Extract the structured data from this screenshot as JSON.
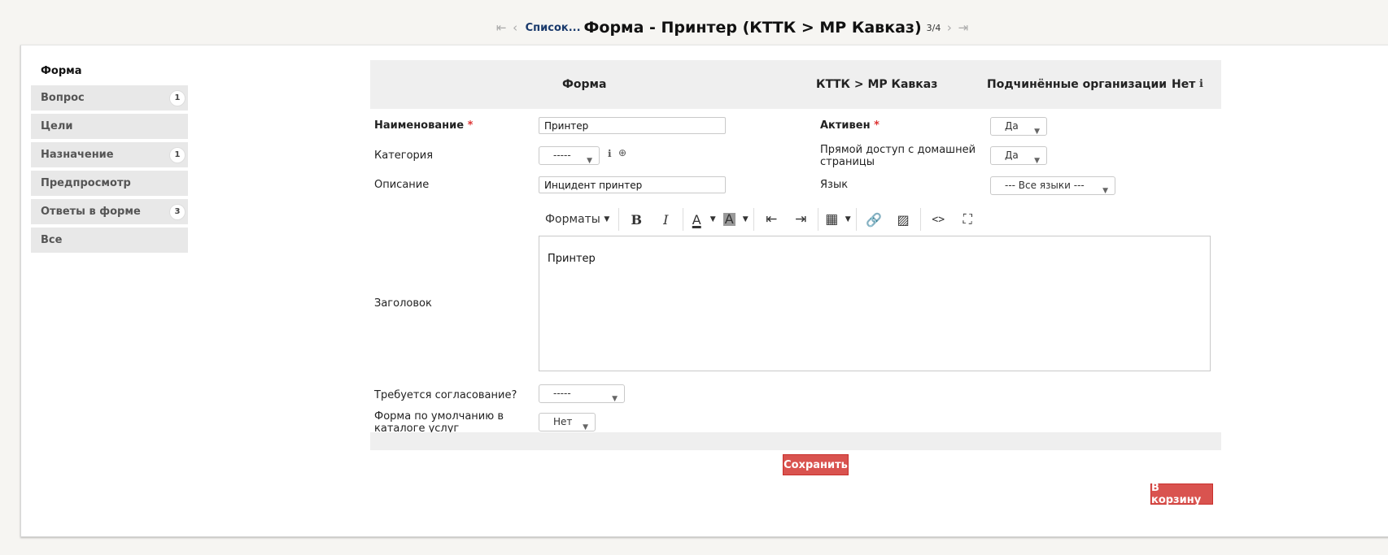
{
  "topnav": {
    "list_link": "Список...",
    "title": "Форма - Принтер (КТТК > МР Кавказ)",
    "counter": "3/4"
  },
  "sidebar": {
    "items": [
      {
        "label": "Форма",
        "badge": ""
      },
      {
        "label": "Вопрос",
        "badge": "1"
      },
      {
        "label": "Цели",
        "badge": ""
      },
      {
        "label": "Назначение",
        "badge": "1"
      },
      {
        "label": "Предпросмотр",
        "badge": ""
      },
      {
        "label": "Ответы в форме",
        "badge": "3"
      },
      {
        "label": "Все",
        "badge": ""
      }
    ]
  },
  "header": {
    "col1": "Форма",
    "col2": "КТТК > МР Кавказ",
    "col3": "Подчинённые организации",
    "col4": "Нет"
  },
  "fields": {
    "name_label": "Наименование",
    "name_value": "Принтер",
    "active_label": "Активен",
    "active_value": "Да",
    "category_label": "Категория",
    "category_value": "-----",
    "direct_access_label_1": "Прямой доступ с домашней",
    "direct_access_label_2": "страницы",
    "direct_access_value": "Да",
    "description_label": "Описание",
    "description_value": "Инцидент принтер",
    "language_label": "Язык",
    "language_value": "--- Все языки ---",
    "title_label": "Заголовок",
    "title_content": "Принтер",
    "approval_label": "Требуется согласование?",
    "approval_value": "-----",
    "default_form_label_1": "Форма по умолчанию в",
    "default_form_label_2": "каталоге услуг",
    "default_form_value": "Нет"
  },
  "toolbar": {
    "formats": "Форматы"
  },
  "buttons": {
    "save": "Сохранить",
    "trash": "В корзину"
  },
  "colors": {
    "accent_red": "#d9534f",
    "link_blue": "#1a3a6c"
  }
}
